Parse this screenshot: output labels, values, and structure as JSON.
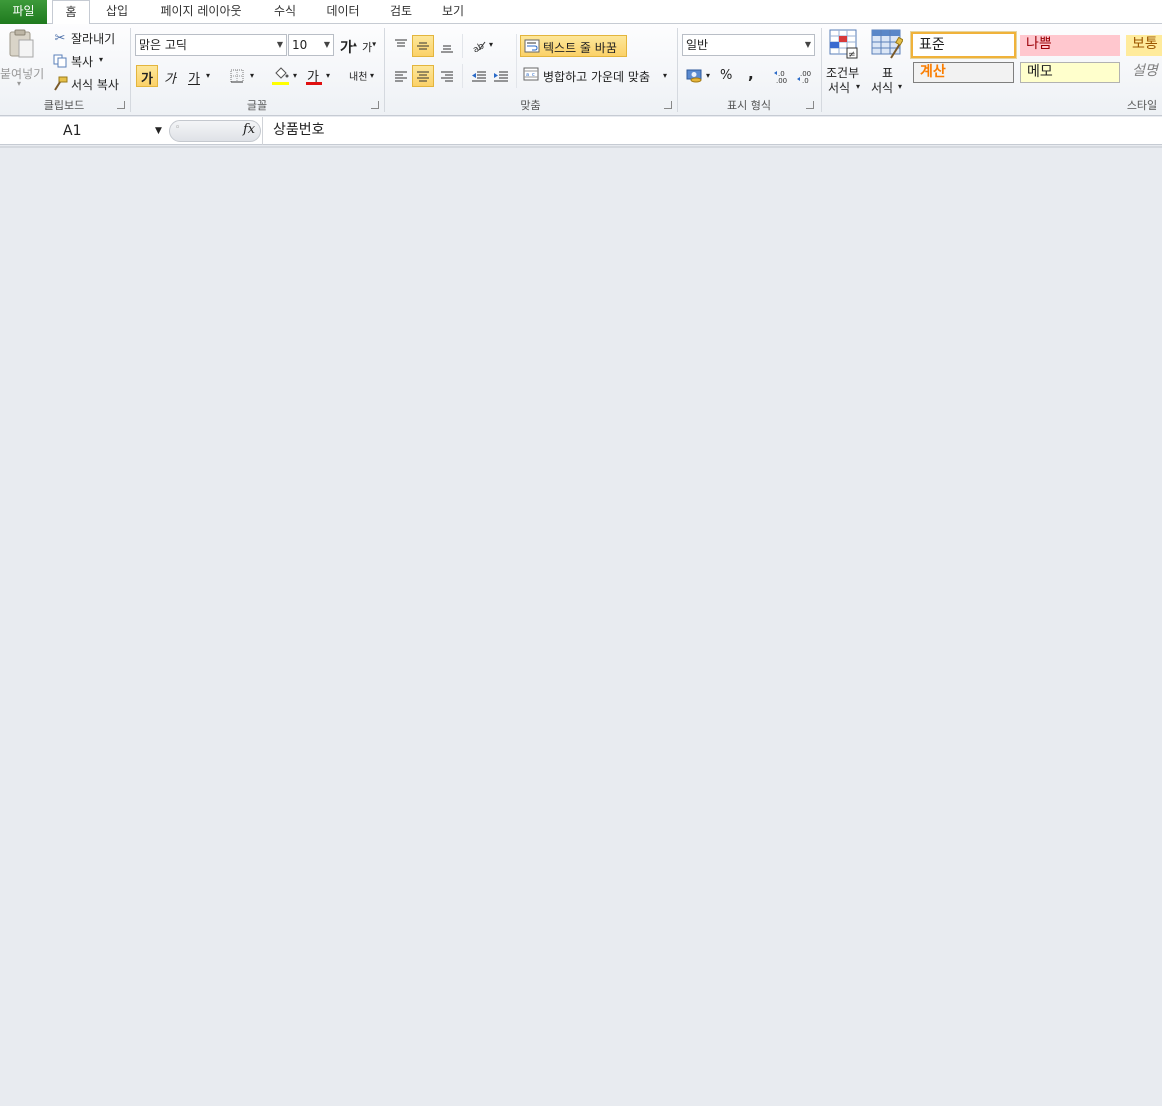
{
  "tabs": {
    "file": "파일",
    "home": "홈",
    "insert": "삽입",
    "page_layout": "페이지 레이아웃",
    "formulas": "수식",
    "data": "데이터",
    "review": "검토",
    "view": "보기"
  },
  "clipboard": {
    "paste": "붙여넣기",
    "cut": "잘라내기",
    "copy": "복사",
    "format_painter": "서식 복사",
    "group_label": "클립보드"
  },
  "font": {
    "name": "맑은 고딕",
    "size": "10",
    "grow": "가",
    "shrink": "가",
    "bold": "가",
    "italic": "가",
    "underline": "가",
    "font_color_glyph": "가",
    "phonetic": "내천",
    "group_label": "글꼴",
    "highlight_color": "#ffff00",
    "font_color": "#e01010"
  },
  "alignment": {
    "wrap_text": "텍스트 줄 바꿈",
    "merge_center": "병합하고 가운데 맞춤",
    "group_label": "맞춤"
  },
  "number": {
    "format": "일반",
    "percent": "%",
    "comma": ",",
    "group_label": "표시 형식"
  },
  "styles": {
    "conditional_line1": "조건부",
    "conditional_line2": "서식",
    "table_line1": "표",
    "table_line2": "서식",
    "normal": "표준",
    "bad": "나쁨",
    "neutral": "보통",
    "calculation": "계산",
    "note": "메모",
    "explanatory": "설명",
    "group_label": "스타일",
    "bad_bg": "#ffc7ce",
    "neutral_bg": "#ffeb9c",
    "note_bg": "#ffffcc",
    "calc_color": "#fa7d00"
  },
  "formula_bar": {
    "name_box": "A1",
    "fx": "fx",
    "content": "상품번호"
  }
}
